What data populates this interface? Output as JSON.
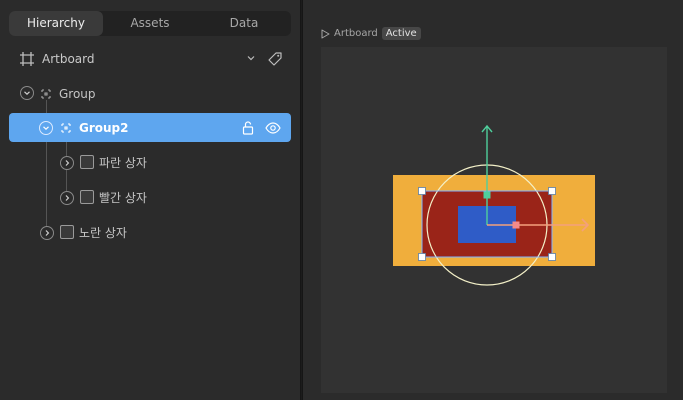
{
  "tabs": [
    {
      "label": "Hierarchy"
    },
    {
      "label": "Assets"
    },
    {
      "label": "Data"
    }
  ],
  "artboard": {
    "label": "Artboard"
  },
  "tree": {
    "group": {
      "label": "Group"
    },
    "group2": {
      "label": "Group2"
    },
    "blue_box": {
      "label": "파란 상자"
    },
    "red_box": {
      "label": "빨간 상자"
    },
    "yellow_box": {
      "label": "노란 상자"
    }
  },
  "stage": {
    "artboard_name": "Artboard",
    "state": "Active"
  },
  "colors": {
    "selection": "#5ea6ef",
    "yellow": "#f0ae3c",
    "red": "#9a2418",
    "blue": "#2f5cc7",
    "axis_y": "#4fcf9c",
    "axis_x": "#f4a07c"
  }
}
